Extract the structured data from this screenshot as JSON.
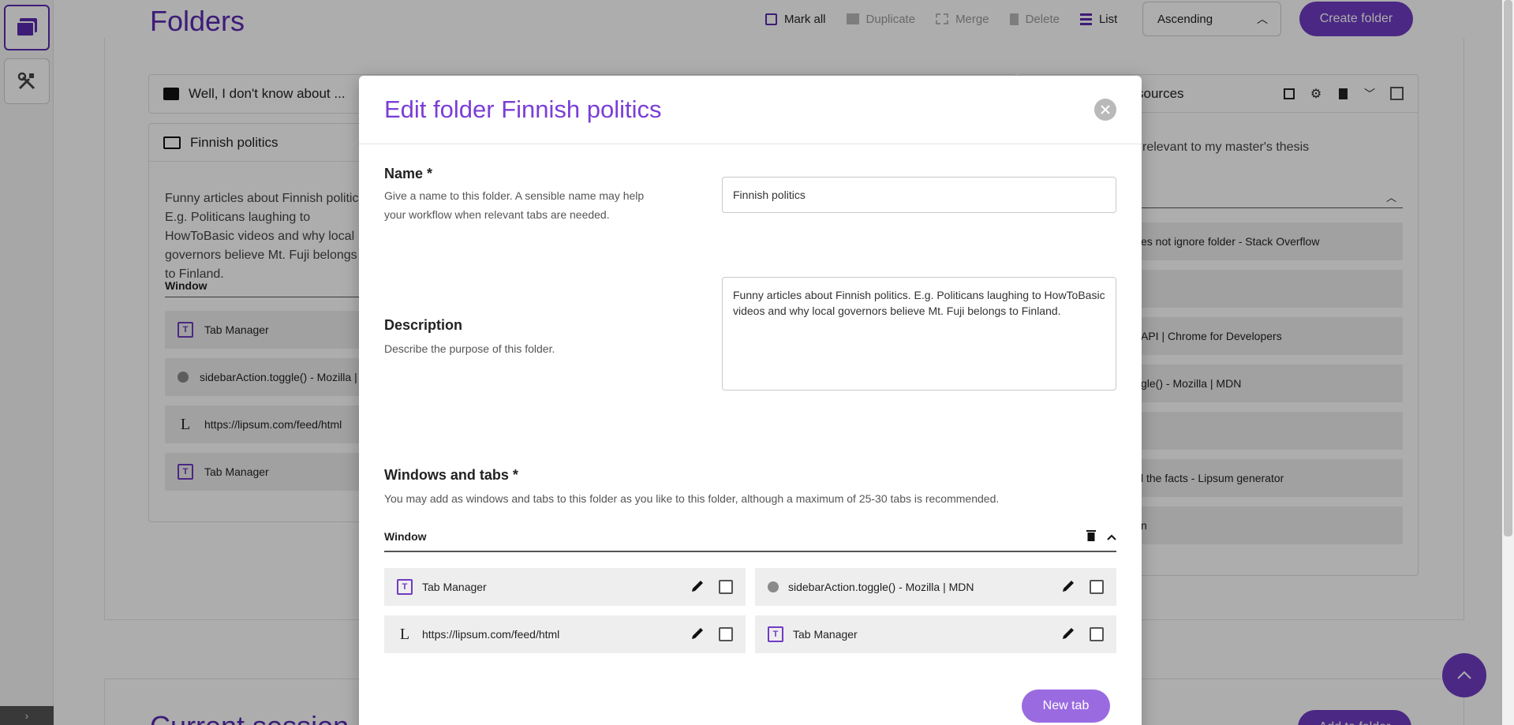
{
  "page": {
    "title": "Folders",
    "toolbar": {
      "mark_all": "Mark all",
      "duplicate": "Duplicate",
      "merge": "Merge",
      "delete": "Delete",
      "list": "List"
    },
    "sort_value": "Ascending",
    "create_folder": "Create folder",
    "second_section_title": "Current session",
    "second_button": "Add to folder"
  },
  "folders": {
    "folder1_name": "Well, I don't know about ...",
    "folder2_name": "Finnish politics",
    "folder2_description": "Funny articles about Finnish politics. E.g. Politicans laughing to HowToBasic videos and why local governors believe Mt. Fuji belongs to Finland.",
    "folder2_window_label": "Window",
    "folder2_tabs": [
      "Tab Manager",
      "sidebarAction.toggle() - Mozilla | MDN",
      "https://lipsum.com/feed/html",
      "Tab Manager"
    ],
    "folder3_name_partial": "sources",
    "folder3_desc_partial": "relevant to my master's thesis",
    "folder3_tabs_partial": [
      "es not ignore folder - Stack Overflow",
      "",
      "API  |  Chrome for Developers",
      "gle() - Mozilla | MDN",
      "",
      "l the facts - Lipsum generator",
      "n"
    ]
  },
  "modal": {
    "title": "Edit folder Finnish politics",
    "name_label": "Name *",
    "name_help": "Give a name to this folder. A sensible name may help your workflow when relevant tabs are needed.",
    "name_value": "Finnish politics",
    "description_label": "Description",
    "description_help": "Describe the purpose of this folder.",
    "description_value": "Funny articles about Finnish politics. E.g. Politicans laughing to HowToBasic videos and why local governors believe Mt. Fuji belongs to Finland.",
    "windows_label": "Windows and tabs *",
    "windows_help": "You may add as windows and tabs to this folder as you like to this folder, although a maximum of 25-30 tabs is recommended.",
    "window_label": "Window",
    "tabs": [
      {
        "label": "Tab Manager",
        "icon": "tab-manager-icon"
      },
      {
        "label": "sidebarAction.toggle() - Mozilla | MDN",
        "icon": "globe-icon"
      },
      {
        "label": "https://lipsum.com/feed/html",
        "icon": "lipsum-icon"
      },
      {
        "label": "Tab Manager",
        "icon": "tab-manager-icon"
      }
    ],
    "new_tab": "New tab"
  },
  "colors": {
    "accent": "#6f3bc3",
    "accent_light": "#9a6be0",
    "title_purple": "#7b3ed6"
  }
}
